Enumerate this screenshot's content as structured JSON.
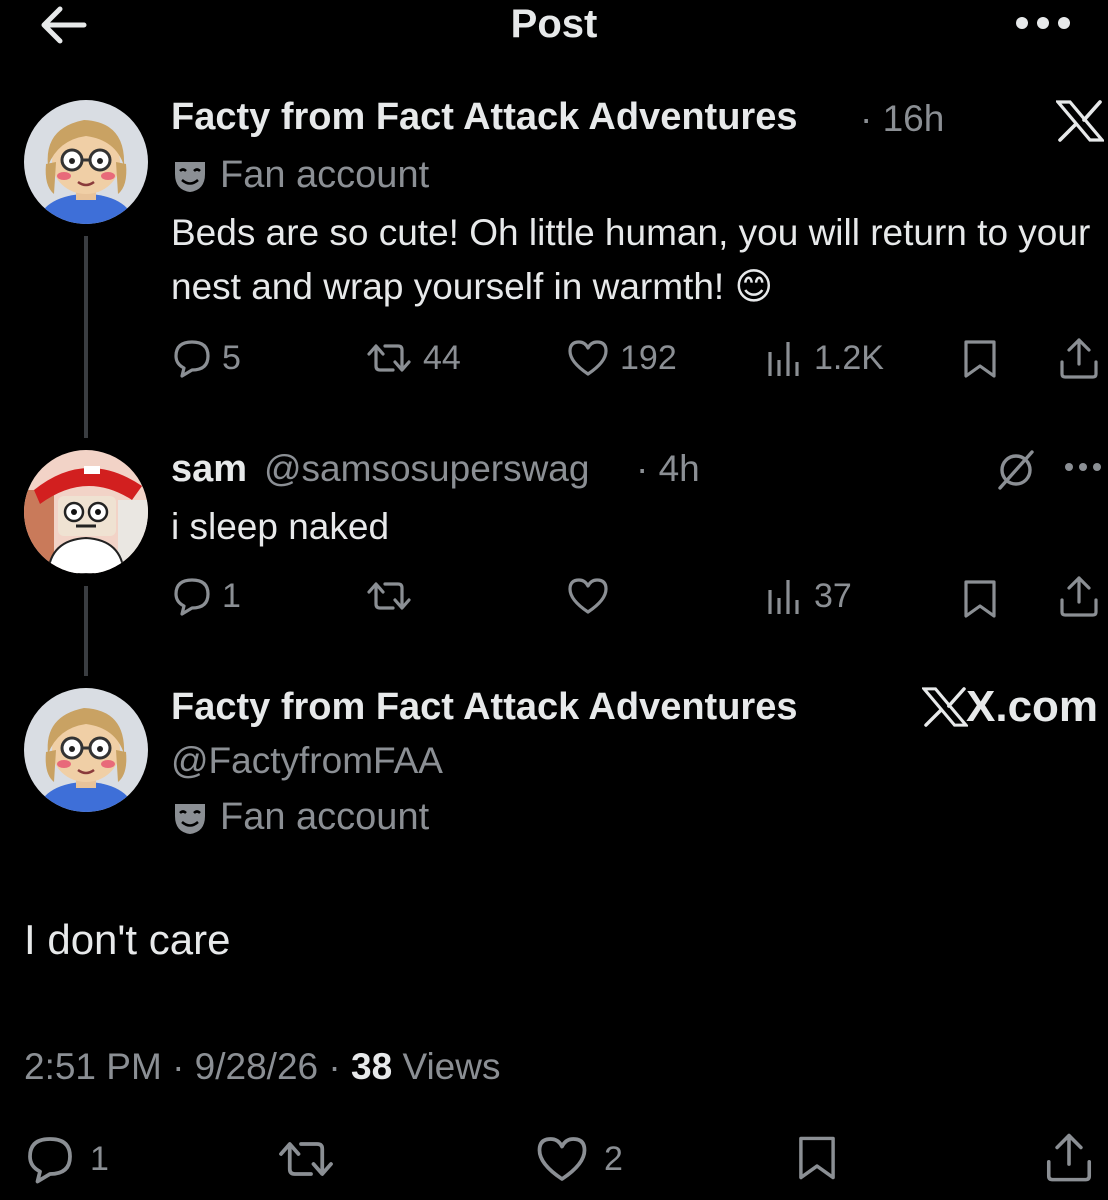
{
  "header": {
    "title": "Post"
  },
  "colors": {
    "background": "#000000",
    "text": "#e7e9ea",
    "secondary": "#8b8f94",
    "thread_line": "#3a3d41"
  },
  "post1": {
    "name": "Facty from Fact Attack Adventures",
    "time": "· 16h",
    "badge": "Fan account",
    "text": "Beds are so cute! Oh little human, you will return to your nest and wrap yourself in warmth!",
    "emoji": "😊",
    "replies": "5",
    "reposts": "44",
    "likes": "192",
    "views": "1.2K"
  },
  "post2": {
    "name": "sam",
    "handle": "@samsosuperswag",
    "time": "· 4h",
    "text": "i sleep naked",
    "replies": "1",
    "reposts": "",
    "likes": "",
    "views": "37"
  },
  "post3": {
    "name": "Facty from Fact Attack Adventures",
    "handle": "@FactyfromFAA",
    "badge": "Fan account",
    "brand": "X.com",
    "text": "I don't care",
    "timestamp": "2:51 PM · 9/28/26 ·",
    "views_count": "38",
    "views_label": "Views",
    "replies": "1",
    "likes": "2"
  },
  "icons": [
    "back-arrow-icon",
    "more-icon",
    "x-logo-icon",
    "mask-icon",
    "reply-icon",
    "repost-icon",
    "like-icon",
    "views-icon",
    "bookmark-icon",
    "share-icon",
    "grok-icon"
  ]
}
